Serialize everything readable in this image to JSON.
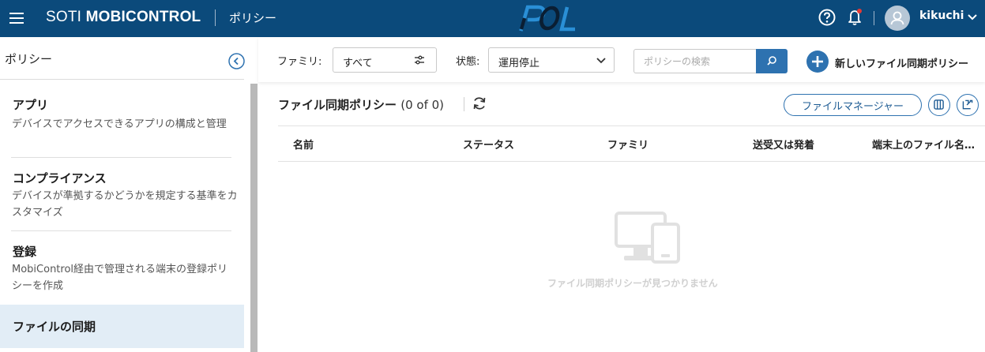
{
  "header": {
    "brand_light": "SOTI ",
    "brand_bold": "MOBICONTROL",
    "section": "ポリシー",
    "username": "kikuchi",
    "colors": {
      "bar": "#0b4a7b",
      "accent": "#2e72b0",
      "notification_dot": "#e53935"
    }
  },
  "sidebar": {
    "title": "ポリシー",
    "items": [
      {
        "title": "アプリ",
        "desc": "デバイスでアクセスできるアプリの構成と管理"
      },
      {
        "title": "コンプライアンス",
        "desc": "デバイスが準拠するかどうかを規定する基準をカスタマイズ"
      },
      {
        "title": "登録",
        "desc": "MobiControl経由で管理される端末の登録ポリシーを作成"
      },
      {
        "title": "ファイルの同期",
        "desc": ""
      }
    ]
  },
  "filters": {
    "family_label": "ファミリ:",
    "family_value": "すべて",
    "status_label": "状態:",
    "status_value": "運用停止",
    "search_placeholder": "ポリシーの検索",
    "new_policy_label": "新しいファイル同期ポリシー"
  },
  "main": {
    "list_title": "ファイル同期ポリシー",
    "list_count": "(0 of 0)",
    "file_manager_label": "ファイルマネージャー",
    "columns": [
      "名前",
      "ステータス",
      "ファミリ",
      "送受又は発着",
      "端末上のファイル名…"
    ],
    "empty_message": "ファイル同期ポリシーが見つかりません"
  }
}
